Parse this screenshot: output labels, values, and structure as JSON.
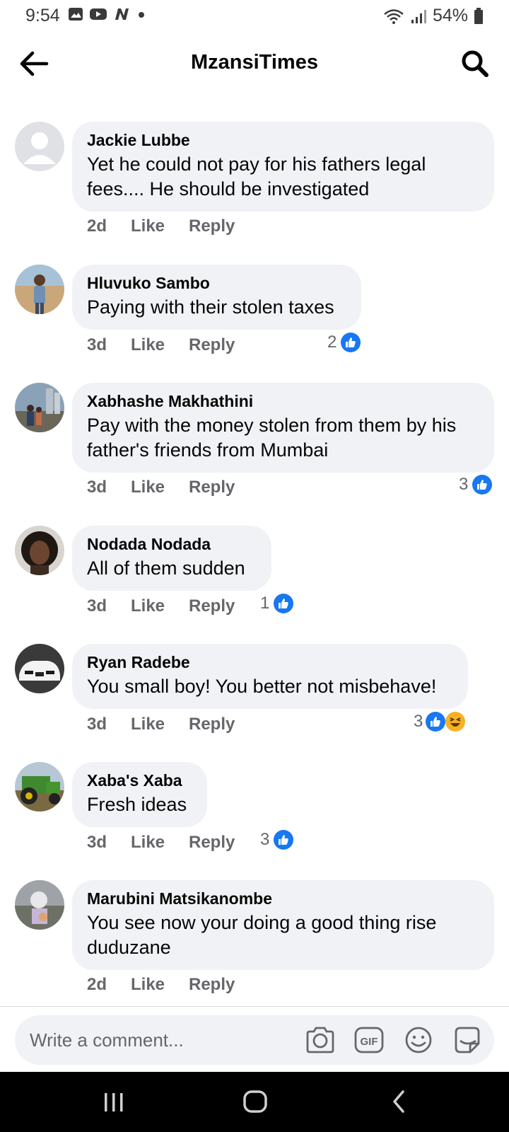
{
  "status_bar": {
    "time": "9:54",
    "battery": "54%"
  },
  "header": {
    "title": "MzansiTimes"
  },
  "comments": [
    {
      "author": "Jackie Lubbe",
      "lines": [
        "Yet he could not pay for his fathers legal",
        "fees.... He should be investigated"
      ],
      "time": "2d",
      "like": "Like",
      "reply": "Reply",
      "reaction_count": "",
      "reactions": []
    },
    {
      "author": "Hluvuko Sambo",
      "lines": [
        "Paying with their stolen taxes"
      ],
      "time": "3d",
      "like": "Like",
      "reply": "Reply",
      "reaction_count": "2",
      "reactions": [
        "like"
      ]
    },
    {
      "author": "Xabhashe Makhathini",
      "lines": [
        "Pay with the money stolen from them by his",
        "father's friends from Mumbai"
      ],
      "time": "3d",
      "like": "Like",
      "reply": "Reply",
      "reaction_count": "3",
      "reactions": [
        "like"
      ]
    },
    {
      "author": "Nodada Nodada",
      "lines": [
        "All of them sudden"
      ],
      "time": "3d",
      "like": "Like",
      "reply": "Reply",
      "reaction_count": "1",
      "reactions": [
        "like"
      ]
    },
    {
      "author": "Ryan Radebe",
      "lines": [
        "You small boy! You better not misbehave!"
      ],
      "time": "3d",
      "like": "Like",
      "reply": "Reply",
      "reaction_count": "3",
      "reactions": [
        "like",
        "haha"
      ]
    },
    {
      "author": "Xaba's Xaba",
      "lines": [
        "Fresh ideas"
      ],
      "time": "3d",
      "like": "Like",
      "reply": "Reply",
      "reaction_count": "3",
      "reactions": [
        "like"
      ]
    },
    {
      "author": "Marubini Matsikanombe",
      "lines": [
        "You see now your doing a good thing rise",
        "duduzane"
      ],
      "time": "2d",
      "like": "Like",
      "reply": "Reply",
      "reaction_count": "",
      "reactions": []
    }
  ],
  "composer": {
    "placeholder": "Write a comment..."
  },
  "colors": {
    "like_blue": "#1877f2",
    "bubble_bg": "#f0f2f5",
    "secondary_text": "#65676b",
    "haha_yellow": "#f7b125"
  },
  "icons": [
    "back-arrow-icon",
    "search-icon",
    "camera-icon",
    "gif-icon",
    "emoji-icon",
    "sticker-icon",
    "recents-icon",
    "home-icon",
    "back-nav-icon"
  ]
}
